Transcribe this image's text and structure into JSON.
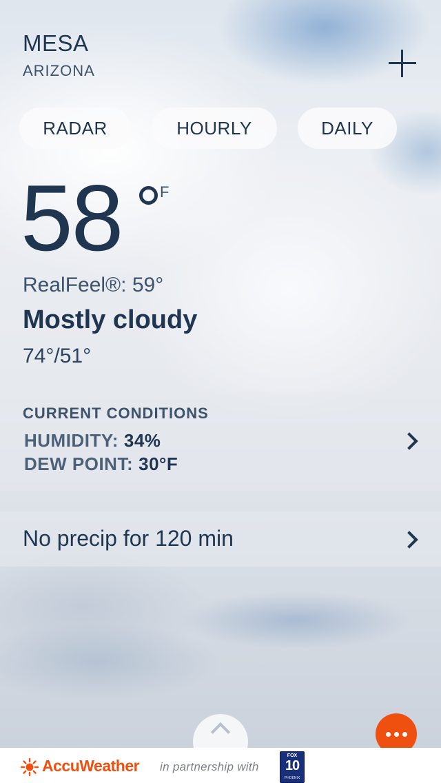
{
  "location": {
    "city": "MESA",
    "state": "ARIZONA",
    "add_icon": "plus-icon"
  },
  "nav_pills": {
    "radar": "RADAR",
    "hourly": "HOURLY",
    "daily": "DAILY"
  },
  "current": {
    "temperature": "58",
    "unit": "F",
    "realfeel": "RealFeel®: 59°",
    "condition": "Mostly cloudy",
    "high_low": "74°/51°"
  },
  "current_conditions": {
    "title": "CURRENT CONDITIONS",
    "humidity_label": "HUMIDITY:",
    "humidity_value": "34%",
    "dew_point_label": "DEW POINT:",
    "dew_point_value": "30°F"
  },
  "precip": {
    "text": "No precip for 120 min"
  },
  "footer": {
    "brand": "AccuWeather",
    "partnership": "in partnership with",
    "partner_logo_top": "FOX",
    "partner_logo_number": "10",
    "partner_logo_bottom": "PHOENIX"
  },
  "colors": {
    "accent": "#f0500f",
    "text_primary": "#1f3550"
  },
  "icons": {
    "add": "plus-icon",
    "chevron": "chevron-right-icon",
    "expand": "chevron-up-icon",
    "more": "more-horizontal-icon",
    "brand": "accuweather-sun-icon"
  }
}
